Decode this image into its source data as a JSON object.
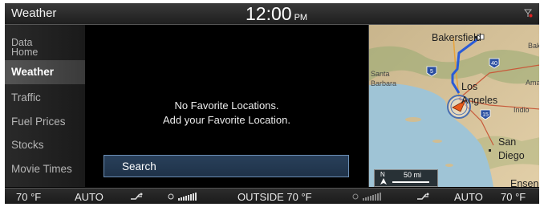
{
  "header": {
    "title": "Weather",
    "time": "12:00",
    "ampm": "PM"
  },
  "sidebar": {
    "items": [
      {
        "label_line1": "Data",
        "label_line2": "Home"
      },
      {
        "label": "Weather",
        "active": true
      },
      {
        "label": "Traffic"
      },
      {
        "label": "Fuel Prices"
      },
      {
        "label": "Stocks"
      },
      {
        "label": "Movie Times"
      }
    ]
  },
  "main": {
    "message_line1": "No Favorite Locations.",
    "message_line2": "Add your Favorite Location.",
    "search_label": "Search"
  },
  "map": {
    "labels": {
      "bakersfield": "Bakersfield",
      "bak": "Bak",
      "los": "Los",
      "angeles": "Angeles",
      "ama": "Ama",
      "santa": "Santa",
      "barbara": "Barbara",
      "indio": "Indio",
      "san": "San",
      "diego": "Diego",
      "ensen": "Ensen"
    },
    "shields": {
      "i5": "5",
      "i40": "40",
      "i15": "15"
    },
    "scale": {
      "compass": "N",
      "distance": "50 mi"
    }
  },
  "climate": {
    "left_temp": "70 °F",
    "left_mode": "AUTO",
    "outside": "OUTSIDE  70 °F",
    "right_mode": "AUTO",
    "right_temp": "70 °F"
  },
  "colors": {
    "accent_route": "#2a5bd7",
    "search_border": "#6c8fb5"
  }
}
